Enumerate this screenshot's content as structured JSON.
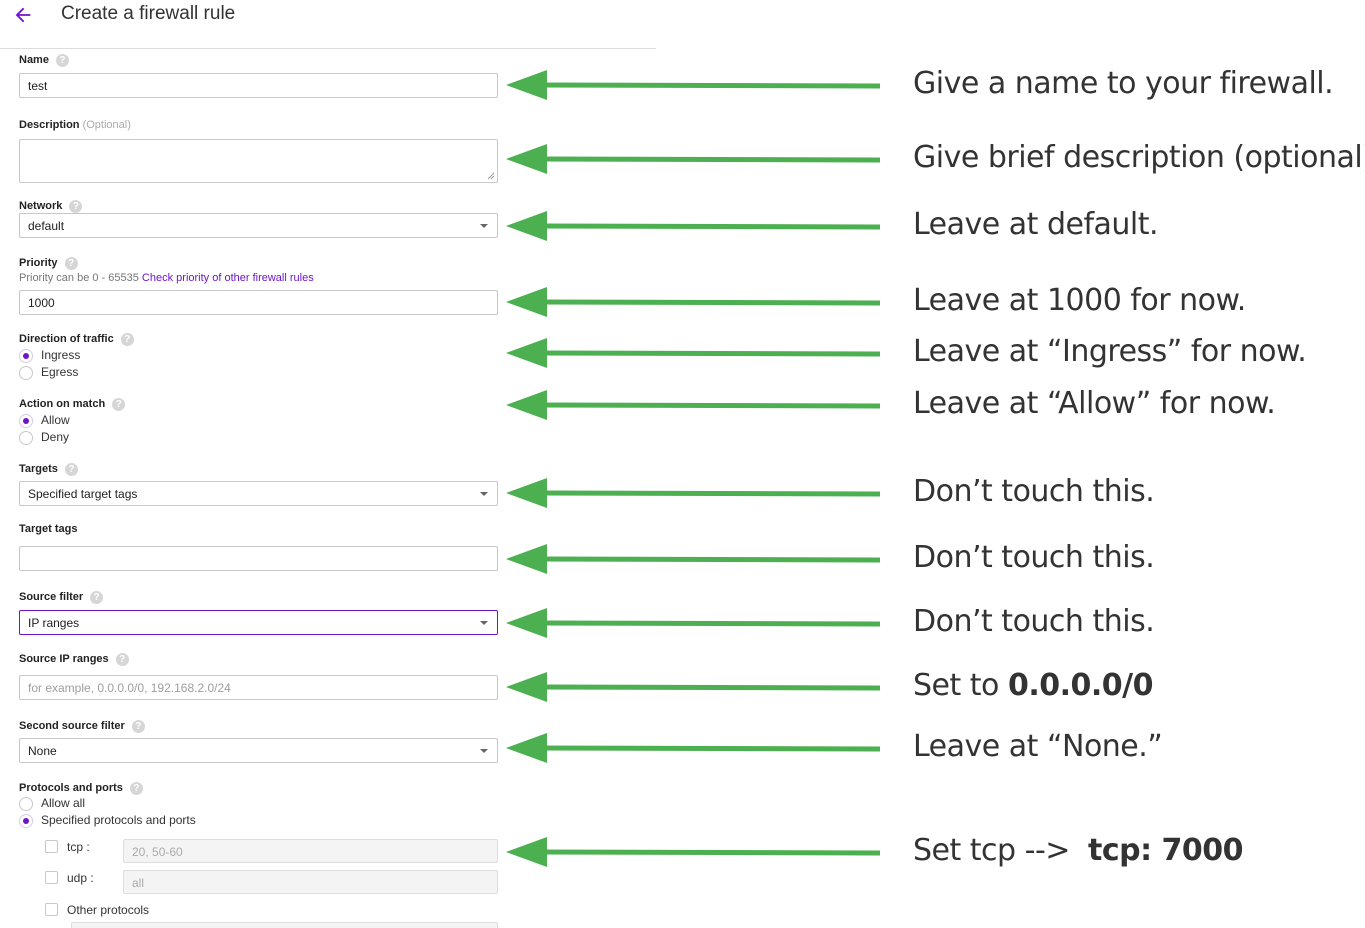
{
  "header": {
    "title": "Create a firewall rule",
    "back_icon": "arrow-left-icon"
  },
  "form": {
    "name": {
      "label": "Name",
      "value": "test"
    },
    "description": {
      "label": "Description",
      "optional": "(Optional)",
      "value": ""
    },
    "network": {
      "label": "Network",
      "value": "default"
    },
    "priority": {
      "label": "Priority",
      "hint": "Priority can be 0 - 65535",
      "link": "Check priority of other firewall rules",
      "value": "1000"
    },
    "direction": {
      "label": "Direction of traffic",
      "options": [
        "Ingress",
        "Egress"
      ],
      "selected": "Ingress"
    },
    "action": {
      "label": "Action on match",
      "options": [
        "Allow",
        "Deny"
      ],
      "selected": "Allow"
    },
    "targets": {
      "label": "Targets",
      "value": "Specified target tags"
    },
    "target_tags": {
      "label": "Target tags",
      "value": ""
    },
    "source_filter": {
      "label": "Source filter",
      "value": "IP ranges"
    },
    "source_ip_ranges": {
      "label": "Source IP ranges",
      "placeholder": "for example, 0.0.0.0/0, 192.168.2.0/24"
    },
    "second_source_filter": {
      "label": "Second source filter",
      "value": "None"
    },
    "protocols": {
      "label": "Protocols and ports",
      "options": [
        "Allow all",
        "Specified protocols and ports"
      ],
      "selected": "Specified protocols and ports",
      "tcp": {
        "label": "tcp :",
        "placeholder": "20, 50-60"
      },
      "udp": {
        "label": "udp :",
        "placeholder": "all"
      },
      "other": {
        "label": "Other protocols"
      }
    }
  },
  "notes": {
    "name": "Give a name to your firewall.",
    "description": "Give brief description (optional).",
    "network": "Leave at default.",
    "priority": "Leave at 1000 for now.",
    "direction": "Leave at “Ingress” for now.",
    "action": "Leave at “Allow” for now.",
    "targets": "Don’t touch this.",
    "target_tags": "Don’t touch this.",
    "source_filter": "Don’t touch this.",
    "source_ip_prefix": "Set to ",
    "source_ip_bold": "0.0.0.0/0",
    "second_source": "Leave at “None.”",
    "tcp_prefix": "Set tcp -->  ",
    "tcp_bold": "tcp: 7000"
  },
  "colors": {
    "accent": "#6f14c9",
    "arrow": "#4caf50"
  }
}
